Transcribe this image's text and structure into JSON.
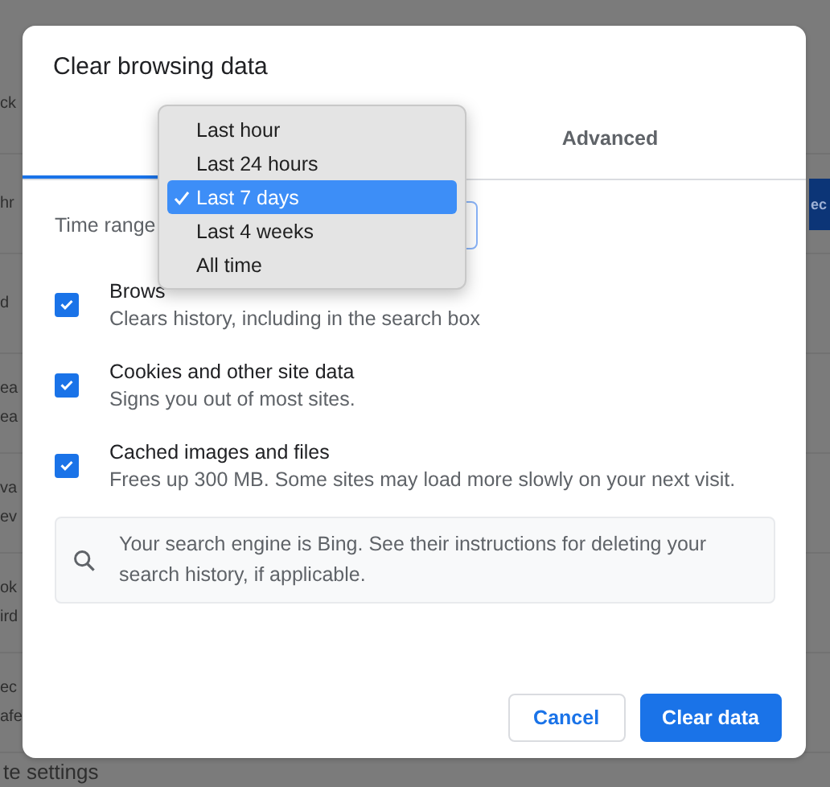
{
  "background_page": {
    "sections": [
      {
        "lines": [
          "ck"
        ]
      },
      {
        "lines": [
          "hr"
        ],
        "button": "ec"
      },
      {
        "lines": [
          "d"
        ]
      },
      {
        "lines": [
          "ea",
          "ea"
        ]
      },
      {
        "lines": [
          "va",
          "ev"
        ]
      },
      {
        "lines": [
          "ok",
          "ird"
        ]
      },
      {
        "lines": [
          "ec",
          "afe"
        ]
      },
      {
        "lines": [
          "te settings"
        ]
      }
    ]
  },
  "dialog": {
    "title": "Clear browsing data",
    "tabs": [
      {
        "selected": true
      },
      {
        "label": "Advanced",
        "selected": false
      }
    ],
    "time_range": {
      "label": "Time range"
    },
    "time_menu": [
      {
        "label": "Last hour",
        "selected": false
      },
      {
        "label": "Last 24 hours",
        "selected": false
      },
      {
        "label": "Last 7 days",
        "selected": true
      },
      {
        "label": "Last 4 weeks",
        "selected": false
      },
      {
        "label": "All time",
        "selected": false
      }
    ],
    "options": [
      {
        "label": "Brows",
        "description": "Clears history, including in the search box",
        "checked": true
      },
      {
        "label": "Cookies and other site data",
        "description": "Signs you out of most sites.",
        "checked": true
      },
      {
        "label": "Cached images and files",
        "description": "Frees up 300 MB. Some sites may load more slowly on your next visit.",
        "checked": true
      }
    ],
    "notice": "Your search engine is Bing. See their instructions for deleting your search history, if applicable.",
    "buttons": [
      {
        "label": "Cancel",
        "kind": "secondary"
      },
      {
        "label": "Clear data",
        "kind": "primary"
      }
    ]
  }
}
